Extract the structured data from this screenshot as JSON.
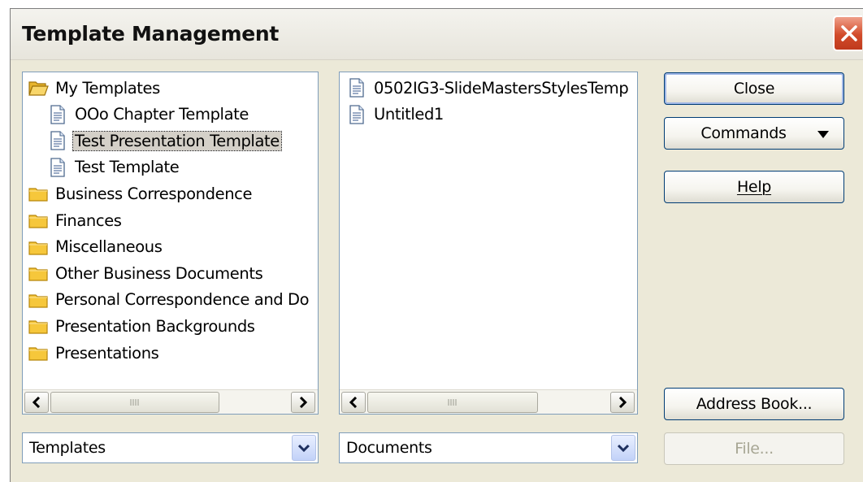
{
  "window": {
    "title": "Template Management"
  },
  "categories": {
    "items": [
      {
        "label": "My Templates",
        "icon": "folder-open-icon",
        "level": 0
      },
      {
        "label": "OOo Chapter Template",
        "icon": "document-icon",
        "level": 1
      },
      {
        "label": "Test Presentation Template",
        "icon": "document-icon",
        "level": 1,
        "selected": true
      },
      {
        "label": "Test Template",
        "icon": "document-icon",
        "level": 1
      },
      {
        "label": "Business Correspondence",
        "icon": "folder-icon",
        "level": 0
      },
      {
        "label": "Finances",
        "icon": "folder-icon",
        "level": 0
      },
      {
        "label": "Miscellaneous",
        "icon": "folder-icon",
        "level": 0
      },
      {
        "label": "Other Business Documents",
        "icon": "folder-icon",
        "level": 0
      },
      {
        "label": "Personal Correspondence and Do",
        "icon": "folder-icon",
        "level": 0
      },
      {
        "label": "Presentation Backgrounds",
        "icon": "folder-icon",
        "level": 0
      },
      {
        "label": "Presentations",
        "icon": "folder-icon",
        "level": 0
      }
    ]
  },
  "documents": {
    "items": [
      {
        "label": "0502IG3-SlideMastersStylesTemp",
        "icon": "document-icon"
      },
      {
        "label": "Untitled1",
        "icon": "document-icon"
      }
    ]
  },
  "buttons": {
    "close": "Close",
    "commands": "Commands",
    "help": "Help",
    "address_book": "Address Book...",
    "file": "File..."
  },
  "combos": {
    "left": "Templates",
    "right": "Documents"
  },
  "colors": {
    "accent_border": "#003c74",
    "panel_border": "#7f9db9",
    "dialog_bg": "#ece9d8"
  }
}
